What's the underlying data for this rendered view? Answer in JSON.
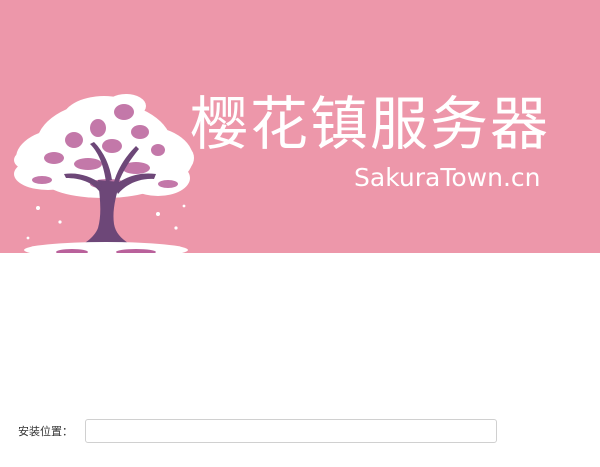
{
  "banner": {
    "title": "樱花镇服务器",
    "subtitle": "SakuraTown.cn",
    "logo_icon": "sakura-tree-icon",
    "background_color": "#ed97aa",
    "text_color": "#ffffff"
  },
  "install": {
    "label": "安装位置：",
    "value": "",
    "placeholder": ""
  }
}
